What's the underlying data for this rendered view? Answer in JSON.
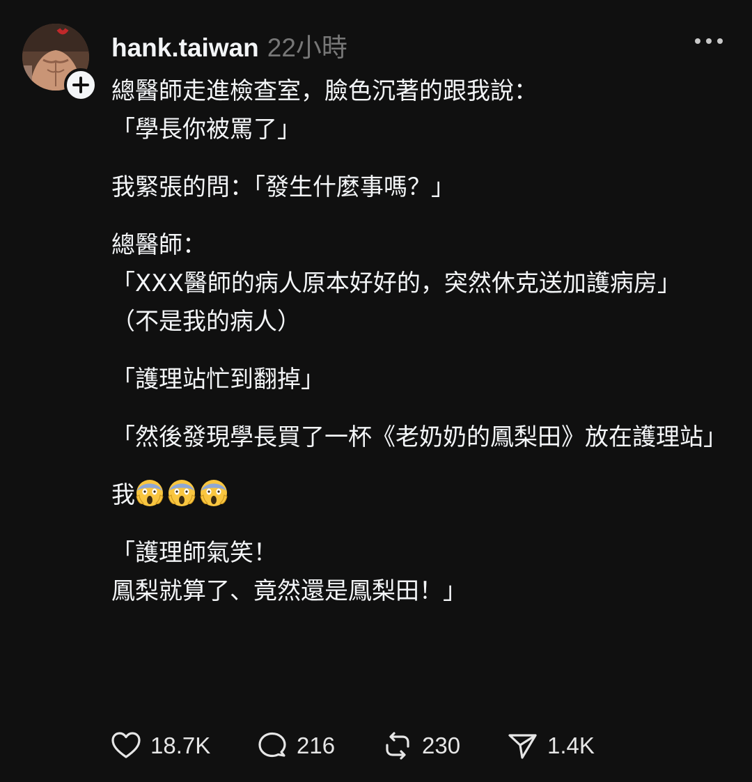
{
  "post": {
    "username": "hank.taiwan",
    "timestamp": "22小時",
    "paragraphs": [
      "總醫師走進檢查室，臉色沉著的跟我說：\n「學長你被罵了」",
      "我緊張的問：「發生什麼事嗎？」",
      "總醫師：\n「XXX醫師的病人原本好好的，突然休克送加護病房」\n（不是我的病人）",
      "「護理站忙到翻掉」",
      "「然後發現學長買了一杯《老奶奶的鳳梨田》放在護理站」"
    ],
    "reaction_line": {
      "text": "我",
      "emojis": [
        "face-screaming-in-fear",
        "face-screaming-in-fear",
        "face-screaming-in-fear"
      ]
    },
    "final_paragraph": "「護理師氣笑！\n鳳梨就算了、竟然還是鳳梨田！」"
  },
  "actions": {
    "likes": "18.7K",
    "replies": "216",
    "reposts": "230",
    "shares": "1.4K"
  },
  "icons": {
    "more": "more-horizontal-icon",
    "follow": "plus-icon",
    "like": "heart-icon",
    "reply": "comment-icon",
    "repost": "repost-icon",
    "share": "send-icon"
  },
  "colors": {
    "background": "#101010",
    "text": "#f3f5f7",
    "muted": "#777777"
  }
}
